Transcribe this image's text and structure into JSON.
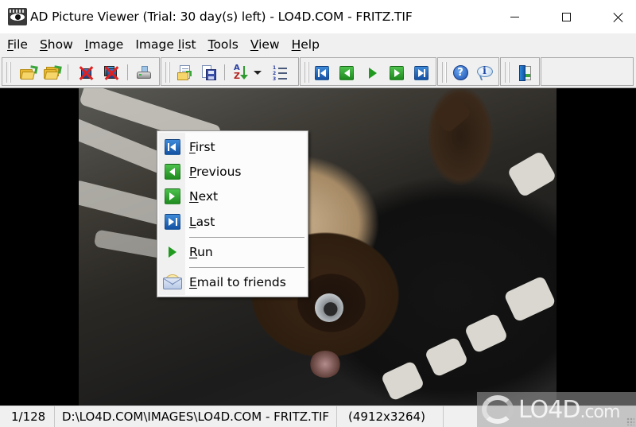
{
  "window": {
    "title": "AD Picture Viewer (Trial: 30 day(s) left) - LO4D.COM - FRITZ.TIF",
    "app_icon": "eye-icon",
    "controls": {
      "minimize": "minimize-icon",
      "maximize": "maximize-icon",
      "close": "close-icon"
    }
  },
  "menubar": {
    "items": [
      {
        "label": "File",
        "accel": "F",
        "rest": "ile"
      },
      {
        "label": "Show",
        "accel": "S",
        "rest": "how"
      },
      {
        "label": "Image",
        "accel": "I",
        "rest": "mage"
      },
      {
        "label": "Image list",
        "pre": "Image ",
        "accel": "l",
        "rest": "ist"
      },
      {
        "label": "Tools",
        "accel": "T",
        "rest": "ools"
      },
      {
        "label": "View",
        "accel": "V",
        "rest": "iew"
      },
      {
        "label": "Help",
        "accel": "H",
        "rest": "elp"
      }
    ]
  },
  "toolbar": {
    "buttons": [
      {
        "name": "open",
        "icon": "folder-open-icon"
      },
      {
        "name": "open-folder",
        "icon": "folders-open-icon"
      },
      {
        "name": "close-image",
        "icon": "close-image-icon"
      },
      {
        "name": "close-all",
        "icon": "close-all-images-icon"
      },
      {
        "name": "print",
        "icon": "printer-icon"
      },
      {
        "name": "open-list",
        "icon": "open-list-icon"
      },
      {
        "name": "save-list",
        "icon": "save-list-icon"
      },
      {
        "name": "sort",
        "icon": "sort-az-icon"
      },
      {
        "name": "sort-dropdown",
        "icon": "dropdown-arrow-icon"
      },
      {
        "name": "numbered-list",
        "icon": "numbered-list-icon"
      },
      {
        "name": "first",
        "icon": "first-icon"
      },
      {
        "name": "previous",
        "icon": "previous-icon"
      },
      {
        "name": "run",
        "icon": "play-icon"
      },
      {
        "name": "next",
        "icon": "next-icon"
      },
      {
        "name": "last",
        "icon": "last-icon"
      },
      {
        "name": "help",
        "icon": "help-icon",
        "glyph": "?"
      },
      {
        "name": "about",
        "icon": "info-icon",
        "glyph": "i"
      },
      {
        "name": "exit",
        "icon": "exit-door-icon"
      }
    ]
  },
  "context_menu": {
    "items": [
      {
        "label": "First",
        "accel": "F",
        "rest": "irst",
        "icon": "first-icon"
      },
      {
        "label": "Previous",
        "accel": "P",
        "rest": "revious",
        "icon": "previous-icon"
      },
      {
        "label": "Next",
        "accel": "N",
        "rest": "ext",
        "icon": "next-icon"
      },
      {
        "label": "Last",
        "accel": "L",
        "rest": "ast",
        "icon": "last-icon"
      },
      {
        "label": "Run",
        "accel": "R",
        "rest": "un",
        "icon": "play-icon"
      },
      {
        "label": "Email to friends",
        "accel": "E",
        "rest": "mail to friends",
        "icon": "envelope-icon"
      }
    ]
  },
  "image": {
    "description": "Siamese cat lying upside down on a black and white striped blanket"
  },
  "statusbar": {
    "position": "1/128",
    "path": "D:\\LO4D.COM\\IMAGES\\LO4D.COM - FRITZ.TIF",
    "dimensions": "(4912x3264)"
  },
  "watermark": {
    "text_main": "LO4D",
    "text_suffix": ".com"
  }
}
